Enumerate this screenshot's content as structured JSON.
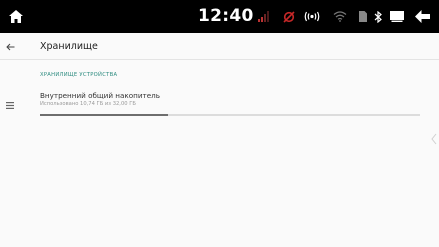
{
  "status_bar": {
    "time": "12:40",
    "icons": [
      "home-icon",
      "signal-bars-icon",
      "sync-off-icon",
      "wireless-broadcast-icon",
      "wifi-icon",
      "sim-card-icon",
      "bluetooth-icon",
      "screen-icon",
      "back-arrow-icon"
    ],
    "accent": "#c62828"
  },
  "app_bar": {
    "title": "Хранилище"
  },
  "section": {
    "header": "ХРАНИЛИЩЕ УСТРОЙСТВА"
  },
  "storage_item": {
    "name": "Внутренний общий накопитель",
    "usage_text": "Использовано 10,74 ГБ из 32,00 ГБ",
    "used_fraction": 0.3356
  },
  "colors": {
    "section_header": "#2a8a7e",
    "bar_fill": "#6e6e6e",
    "bar_track": "#dcdcdc"
  }
}
